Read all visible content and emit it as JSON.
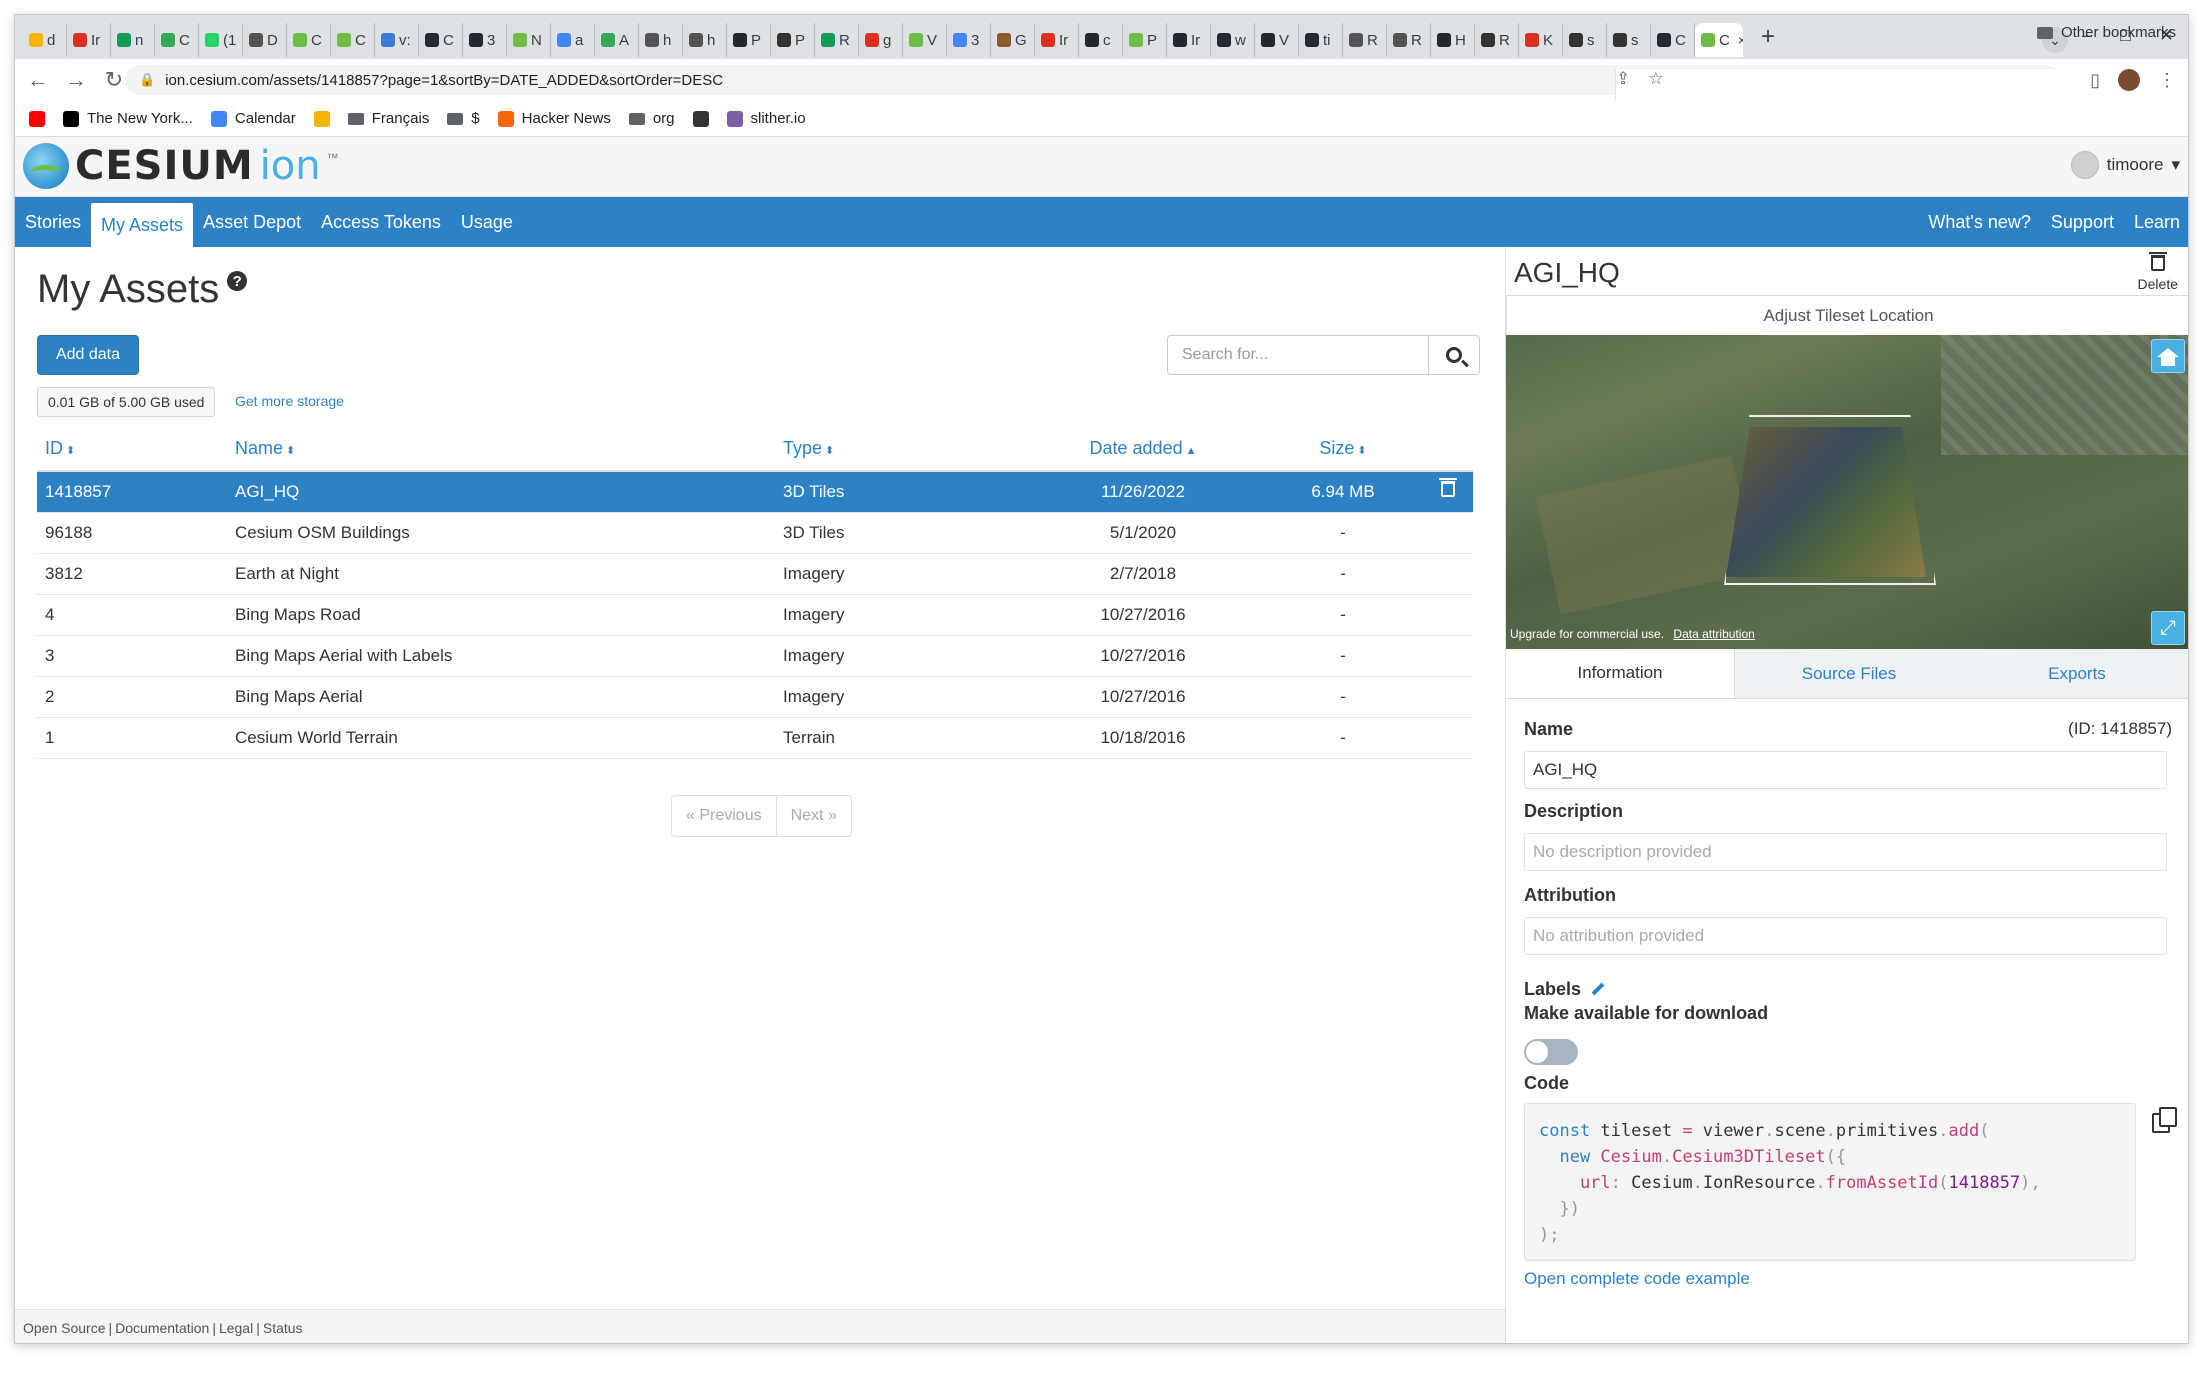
{
  "browser": {
    "tabs": [
      {
        "letter": "d",
        "color": "#f4b400"
      },
      {
        "letter": "Ir",
        "color": "#d93025"
      },
      {
        "letter": "n",
        "color": "#0f9d58"
      },
      {
        "letter": "C",
        "color": "#34a853"
      },
      {
        "letter": "(1",
        "color": "#25d366"
      },
      {
        "letter": "D",
        "color": "#555555"
      },
      {
        "letter": "C",
        "color": "#6dbe45"
      },
      {
        "letter": "C",
        "color": "#6dbe45"
      },
      {
        "letter": "v:",
        "color": "#3d7bd6"
      },
      {
        "letter": "C",
        "color": "#24292f"
      },
      {
        "letter": "3",
        "color": "#24292f"
      },
      {
        "letter": "N",
        "color": "#6dbe45"
      },
      {
        "letter": "a",
        "color": "#4285f4"
      },
      {
        "letter": "A",
        "color": "#34a853"
      },
      {
        "letter": "h",
        "color": "#555555"
      },
      {
        "letter": "h",
        "color": "#555555"
      },
      {
        "letter": "P",
        "color": "#24292f"
      },
      {
        "letter": "P",
        "color": "#333333"
      },
      {
        "letter": "R",
        "color": "#0f9d58"
      },
      {
        "letter": "g",
        "color": "#d93025"
      },
      {
        "letter": "V",
        "color": "#6dbe45"
      },
      {
        "letter": "3",
        "color": "#4285f4"
      },
      {
        "letter": "G",
        "color": "#8a5a2b"
      },
      {
        "letter": "Ir",
        "color": "#d93025"
      },
      {
        "letter": "c",
        "color": "#24292f"
      },
      {
        "letter": "P",
        "color": "#6dbe45"
      },
      {
        "letter": "Ir",
        "color": "#24292f"
      },
      {
        "letter": "w",
        "color": "#24292f"
      },
      {
        "letter": "V",
        "color": "#24292f"
      },
      {
        "letter": "ti",
        "color": "#24292f"
      },
      {
        "letter": "R",
        "color": "#555555"
      },
      {
        "letter": "R",
        "color": "#555555"
      },
      {
        "letter": "H",
        "color": "#24292f"
      },
      {
        "letter": "R",
        "color": "#333333"
      },
      {
        "letter": "K",
        "color": "#d93025"
      },
      {
        "letter": "s",
        "color": "#333333"
      },
      {
        "letter": "s",
        "color": "#333333"
      },
      {
        "letter": "C",
        "color": "#24292f"
      },
      {
        "letter": "C",
        "color": "#6dbe45"
      }
    ],
    "active_tab_close": "×",
    "new_tab": "+",
    "url": "ion.cesium.com/assets/1418857?page=1&sortBy=DATE_ADDED&sortOrder=DESC",
    "window_controls": {
      "minimize": "–",
      "maximize": "□",
      "close": "✕"
    },
    "bookmarks": [
      {
        "label": "",
        "icon": "youtube-icon",
        "color": "#ff0000"
      },
      {
        "label": "The New York...",
        "icon": "nyt-icon",
        "color": "#000000"
      },
      {
        "label": "Calendar",
        "icon": "calendar-icon",
        "color": "#4285f4"
      },
      {
        "label": "",
        "icon": "smiley-icon",
        "color": "#f4b400"
      },
      {
        "label": "Français",
        "icon": "folder-icon",
        "color": "#5f6368"
      },
      {
        "label": "$",
        "icon": "folder-icon",
        "color": "#5f6368"
      },
      {
        "label": "Hacker News",
        "icon": "hn-icon",
        "color": "#ff6600"
      },
      {
        "label": "org",
        "icon": "folder-icon",
        "color": "#5f6368"
      },
      {
        "label": "",
        "icon": "globe-icon",
        "color": "#333333"
      },
      {
        "label": "slither.io",
        "icon": "slither-icon",
        "color": "#7b5ea7"
      }
    ],
    "other_bookmarks": "Other bookmarks"
  },
  "ion": {
    "logo_text": "CESIUM",
    "logo_ion": "ion",
    "logo_tm": "™",
    "username": "timoore",
    "user_caret": "▾",
    "nav_left": [
      "Stories",
      "My Assets",
      "Asset Depot",
      "Access Tokens",
      "Usage"
    ],
    "nav_right": [
      "What's new?",
      "Support",
      "Learn"
    ],
    "active_nav": "My Assets"
  },
  "assets": {
    "title": "My Assets",
    "help": "?",
    "add_button": "Add data",
    "storage_used": "0.01 GB of 5.00 GB used",
    "more_storage": "Get more storage",
    "search_placeholder": "Search for...",
    "columns": {
      "id": "ID",
      "name": "Name",
      "type": "Type",
      "date": "Date added",
      "size": "Size"
    },
    "sort_both": "⬍",
    "sort_up": "▲",
    "rows": [
      {
        "id": "1418857",
        "name": "AGI_HQ",
        "type": "3D Tiles",
        "date": "11/26/2022",
        "size": "6.94 MB",
        "selected": true
      },
      {
        "id": "96188",
        "name": "Cesium OSM Buildings",
        "type": "3D Tiles",
        "date": "5/1/2020",
        "size": "-"
      },
      {
        "id": "3812",
        "name": "Earth at Night",
        "type": "Imagery",
        "date": "2/7/2018",
        "size": "-"
      },
      {
        "id": "4",
        "name": "Bing Maps Road",
        "type": "Imagery",
        "date": "10/27/2016",
        "size": "-"
      },
      {
        "id": "3",
        "name": "Bing Maps Aerial with Labels",
        "type": "Imagery",
        "date": "10/27/2016",
        "size": "-"
      },
      {
        "id": "2",
        "name": "Bing Maps Aerial",
        "type": "Imagery",
        "date": "10/27/2016",
        "size": "-"
      },
      {
        "id": "1",
        "name": "Cesium World Terrain",
        "type": "Terrain",
        "date": "10/18/2016",
        "size": "-"
      }
    ],
    "pager": {
      "prev": "« Previous",
      "next": "Next »"
    }
  },
  "footer": {
    "links": [
      "Open Source",
      "Documentation",
      "Legal",
      "Status"
    ],
    "separator": "|"
  },
  "detail": {
    "title": "AGI_HQ",
    "delete_label": "Delete",
    "adjust_label": "Adjust Tileset Location",
    "credit_text": "Upgrade for commercial use.",
    "credit_link": "Data attribution",
    "fullscreen_glyph": "⤢",
    "tabs": [
      "Information",
      "Source Files",
      "Exports"
    ],
    "active_tab": "Information",
    "name_label": "Name",
    "id_text": "(ID:   1418857)",
    "name_value": "AGI_HQ",
    "description_label": "Description",
    "description_placeholder": "No description provided",
    "attribution_label": "Attribution",
    "attribution_placeholder": "No attribution provided",
    "labels_label": "Labels",
    "download_label": "Make available for download",
    "download_enabled": false,
    "code_label": "Code",
    "code": {
      "l1a": "const",
      "l1b": " tileset ",
      "l1c": "=",
      "l1d": " viewer",
      "l1e": ".",
      "l1f": "scene",
      "l1g": ".",
      "l1h": "primitives",
      "l1i": ".",
      "l1j": "add",
      "l1k": "(",
      "l2a": "  new",
      "l2b": " Cesium",
      "l2c": ".",
      "l2d": "Cesium3DTileset",
      "l2e": "({",
      "l3a": "    url",
      "l3b": ":",
      "l3c": " Cesium",
      "l3d": ".",
      "l3e": "IonResource",
      "l3f": ".",
      "l3g": "fromAssetId",
      "l3h": "(",
      "l3i": "1418857",
      "l3j": "),",
      "l4": "  })",
      "l5": ");"
    },
    "open_code": "Open complete code example"
  }
}
